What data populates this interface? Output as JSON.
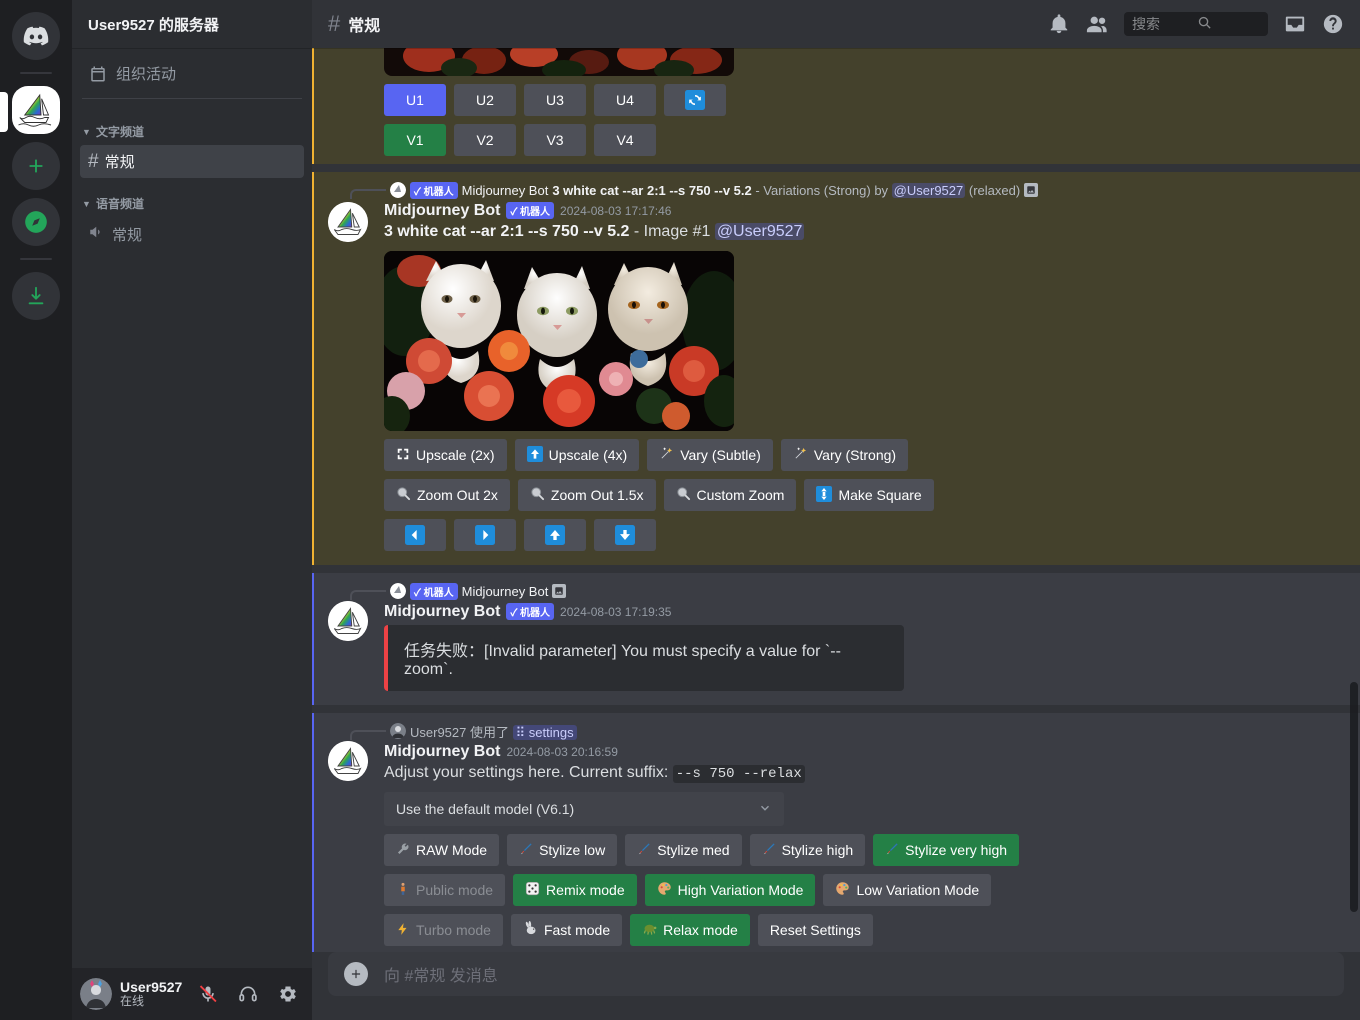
{
  "rail": {
    "items": [
      {
        "name": "discord-home",
        "label": "Discord"
      },
      {
        "name": "server-midjourney",
        "label": "Midjourney"
      },
      {
        "name": "add-server",
        "label": "+"
      },
      {
        "name": "explore-servers",
        "label": "Explore"
      },
      {
        "name": "download-apps",
        "label": "Download"
      }
    ]
  },
  "sidebar": {
    "server_name": "User9527 的服务器",
    "events_label": "组织活动",
    "categories": [
      {
        "label": "文字频道",
        "channels": [
          {
            "label": "常规",
            "type": "text",
            "selected": true
          }
        ]
      },
      {
        "label": "语音频道",
        "channels": [
          {
            "label": "常规",
            "type": "voice",
            "selected": false
          }
        ]
      }
    ],
    "user": {
      "name": "User9527",
      "status": "在线"
    }
  },
  "header": {
    "channel": "常规",
    "search_placeholder": "搜索"
  },
  "messages": [
    {
      "id": "grid-buttons",
      "highlight": "mention",
      "upscale_row": [
        "U1",
        "U2",
        "U3",
        "U4"
      ],
      "reroll_label": "🔄",
      "variation_row": [
        "V1",
        "V2",
        "V3",
        "V4"
      ]
    },
    {
      "id": "image-1",
      "highlight": "mention",
      "reply": {
        "author": "Midjourney Bot",
        "bot_badge": "✓ 机器人",
        "prompt": "3 white cat --ar 2:1 --s 750 --v 5.2",
        "suffix": " - Variations (Strong) by ",
        "mention": "@User9527",
        "trailing": " (relaxed)"
      },
      "author": "Midjourney Bot",
      "bot_badge": "✓ 机器人",
      "timestamp": "2024-08-03 17:17:46",
      "prompt": "3 white cat --ar 2:1 --s 750 --v 5.2",
      "body_suffix": " - Image #1 ",
      "body_mention": "@User9527",
      "buttons_row1": [
        {
          "label": "Upscale (2x)",
          "icon": "⛶",
          "style": "secondary"
        },
        {
          "label": "Upscale (4x)",
          "icon": "🔼",
          "style": "secondary"
        },
        {
          "label": "Vary (Subtle)",
          "icon": "✨",
          "style": "secondary"
        },
        {
          "label": "Vary (Strong)",
          "icon": "✨",
          "style": "secondary"
        }
      ],
      "buttons_row2": [
        {
          "label": "Zoom Out 2x",
          "icon": "🔍",
          "style": "secondary"
        },
        {
          "label": "Zoom Out 1.5x",
          "icon": "🔍",
          "style": "secondary"
        },
        {
          "label": "Custom Zoom",
          "icon": "🔍",
          "style": "secondary"
        },
        {
          "label": "Make Square",
          "icon": "↕",
          "style": "secondary"
        }
      ],
      "buttons_row3": [
        {
          "label": "⬅",
          "style": "secondary"
        },
        {
          "label": "➡",
          "style": "secondary"
        },
        {
          "label": "⬆",
          "style": "secondary"
        },
        {
          "label": "⬇",
          "style": "secondary"
        }
      ]
    },
    {
      "id": "error-msg",
      "highlight": "reply",
      "reply": {
        "author": "Midjourney Bot",
        "bot_badge": "✓ 机器人"
      },
      "author": "Midjourney Bot",
      "bot_badge": "✓ 机器人",
      "timestamp": "2024-08-03 17:19:35",
      "error_text": "任务失败：[Invalid parameter] You must specify a value for `--zoom`."
    },
    {
      "id": "settings-msg",
      "highlight": "reply",
      "command_user": "User9527",
      "command_used_label": "使用了",
      "command_name": "settings",
      "author": "Midjourney Bot",
      "timestamp": "2024-08-03 20:16:59",
      "body_prefix": "Adjust your settings here. Current suffix:",
      "current_suffix": "--s 750 --relax",
      "model_select": "Use the default model (V6.1)",
      "settings_row1": [
        {
          "label": "RAW Mode",
          "icon": "🔧",
          "style": "secondary"
        },
        {
          "label": "Stylize low",
          "icon": "🖌",
          "style": "secondary"
        },
        {
          "label": "Stylize med",
          "icon": "🖌",
          "style": "secondary"
        },
        {
          "label": "Stylize high",
          "icon": "🖌",
          "style": "secondary"
        },
        {
          "label": "Stylize very high",
          "icon": "🖌",
          "style": "success"
        }
      ],
      "settings_row2": [
        {
          "label": "Public mode",
          "icon": "🚶",
          "style": "disabled"
        },
        {
          "label": "Remix mode",
          "icon": "🎲",
          "style": "success"
        },
        {
          "label": "High Variation Mode",
          "icon": "🎨",
          "style": "success"
        },
        {
          "label": "Low Variation Mode",
          "icon": "🎨",
          "style": "secondary"
        }
      ],
      "settings_row3": [
        {
          "label": "Turbo mode",
          "icon": "⚡",
          "style": "disabled"
        },
        {
          "label": "Fast mode",
          "icon": "🐇",
          "style": "secondary"
        },
        {
          "label": "Relax mode",
          "icon": "🐢",
          "style": "success"
        },
        {
          "label": "Reset Settings",
          "icon": "",
          "style": "secondary"
        }
      ]
    }
  ],
  "composer": {
    "placeholder": "向 #常规 发消息"
  },
  "colors": {
    "blurple": "#5865f2",
    "green": "#248046",
    "mention_bg": "#44412c",
    "mention_bar": "#f0b232",
    "error_bar": "#ed4245"
  }
}
